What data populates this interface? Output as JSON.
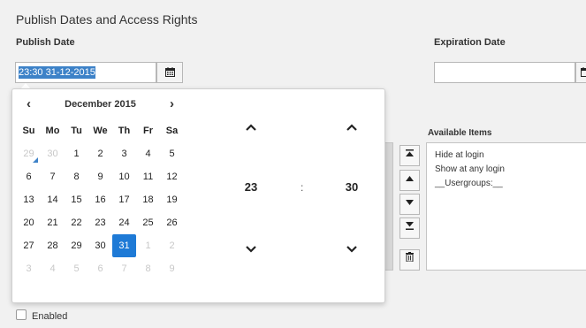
{
  "section": {
    "title": "Publish Dates and Access Rights"
  },
  "publish": {
    "label": "Publish Date",
    "value": "23:30 31-12-2015"
  },
  "expiration": {
    "label": "Expiration Date",
    "value": ""
  },
  "calendar": {
    "prev": "‹",
    "next": "›",
    "month_label": "December 2015",
    "weekdays": [
      "Su",
      "Mo",
      "Tu",
      "We",
      "Th",
      "Fr",
      "Sa"
    ],
    "weeks": [
      [
        {
          "d": "29",
          "c": "old today"
        },
        {
          "d": "30",
          "c": "old"
        },
        {
          "d": "1",
          "c": ""
        },
        {
          "d": "2",
          "c": ""
        },
        {
          "d": "3",
          "c": ""
        },
        {
          "d": "4",
          "c": ""
        },
        {
          "d": "5",
          "c": ""
        }
      ],
      [
        {
          "d": "6",
          "c": ""
        },
        {
          "d": "7",
          "c": ""
        },
        {
          "d": "8",
          "c": ""
        },
        {
          "d": "9",
          "c": ""
        },
        {
          "d": "10",
          "c": ""
        },
        {
          "d": "11",
          "c": ""
        },
        {
          "d": "12",
          "c": ""
        }
      ],
      [
        {
          "d": "13",
          "c": ""
        },
        {
          "d": "14",
          "c": ""
        },
        {
          "d": "15",
          "c": ""
        },
        {
          "d": "16",
          "c": ""
        },
        {
          "d": "17",
          "c": ""
        },
        {
          "d": "18",
          "c": ""
        },
        {
          "d": "19",
          "c": ""
        }
      ],
      [
        {
          "d": "20",
          "c": ""
        },
        {
          "d": "21",
          "c": ""
        },
        {
          "d": "22",
          "c": ""
        },
        {
          "d": "23",
          "c": ""
        },
        {
          "d": "24",
          "c": ""
        },
        {
          "d": "25",
          "c": ""
        },
        {
          "d": "26",
          "c": ""
        }
      ],
      [
        {
          "d": "27",
          "c": ""
        },
        {
          "d": "28",
          "c": ""
        },
        {
          "d": "29",
          "c": ""
        },
        {
          "d": "30",
          "c": ""
        },
        {
          "d": "31",
          "c": "active"
        },
        {
          "d": "1",
          "c": "new"
        },
        {
          "d": "2",
          "c": "new"
        }
      ],
      [
        {
          "d": "3",
          "c": "new"
        },
        {
          "d": "4",
          "c": "new"
        },
        {
          "d": "5",
          "c": "new"
        },
        {
          "d": "6",
          "c": "new"
        },
        {
          "d": "7",
          "c": "new"
        },
        {
          "d": "8",
          "c": "new"
        },
        {
          "d": "9",
          "c": "new"
        }
      ]
    ]
  },
  "time": {
    "hours": "23",
    "separator": ":",
    "minutes": "30"
  },
  "available": {
    "label": "Available Items",
    "items": [
      "Hide at login",
      "Show at any login",
      "__Usergroups:__"
    ]
  },
  "enabled": {
    "label": "Enabled",
    "checked": false
  },
  "colors": {
    "accent": "#1e7ad6",
    "selection": "#3d82c8"
  }
}
